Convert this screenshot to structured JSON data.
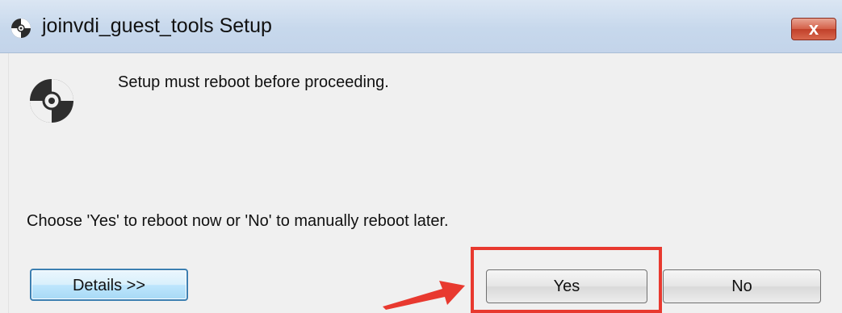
{
  "window": {
    "title": "joinvdi_guest_tools Setup",
    "close_label": "x",
    "icon": "setup-disc-icon"
  },
  "dialog": {
    "icon": "setup-disc-icon",
    "message": "Setup must reboot before proceeding.",
    "instruction": "Choose 'Yes' to reboot now or 'No' to manually reboot later."
  },
  "buttons": {
    "details_label": "Details >>",
    "yes_label": "Yes",
    "no_label": "No"
  },
  "annotation": {
    "highlight_color": "#e8392f",
    "target": "Yes"
  },
  "colors": {
    "titlebar": "#c7d8ec",
    "close_button": "#c1402a",
    "dialog_background": "#f0f0f0",
    "focused_button_border": "#3c7fb1"
  }
}
